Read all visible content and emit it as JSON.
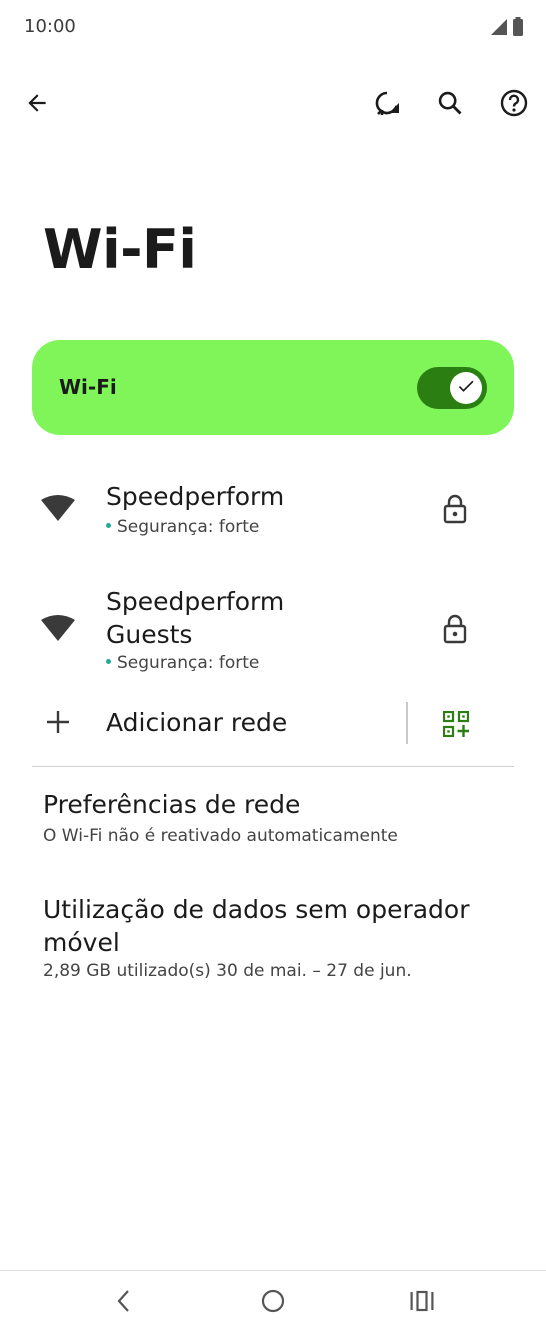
{
  "status_bar": {
    "time": "10:00"
  },
  "toolbar": {
    "back_icon": "arrow-back-icon",
    "refresh_icon": "wifi-refresh-icon",
    "search_icon": "search-icon",
    "help_icon": "help-icon"
  },
  "page_title": "Wi-Fi",
  "wifi_toggle": {
    "label": "Wi-Fi",
    "state": "on",
    "card_color": "#7ff55a",
    "track_color": "#2b7f12"
  },
  "networks": [
    {
      "name_lines": [
        "Speedperform"
      ],
      "status": "Segurança: forte",
      "secured": true
    },
    {
      "name_lines": [
        "Speedperform",
        "Guests"
      ],
      "status": "Segurança: forte",
      "secured": true
    }
  ],
  "add_network": {
    "label": "Adicionar rede",
    "qr_icon": "qr-code-add-icon"
  },
  "preferences": {
    "title": "Preferências de rede",
    "subtitle": "O Wi-Fi não é reativado automaticamente"
  },
  "data_usage": {
    "title": "Utilização de dados sem operador móvel",
    "subtitle": "2,89 GB utilizado(s) 30 de mai. – 27 de jun."
  },
  "nav_bar": {
    "back_icon": "nav-back-icon",
    "home_icon": "nav-home-icon",
    "recents_icon": "nav-recents-icon"
  }
}
